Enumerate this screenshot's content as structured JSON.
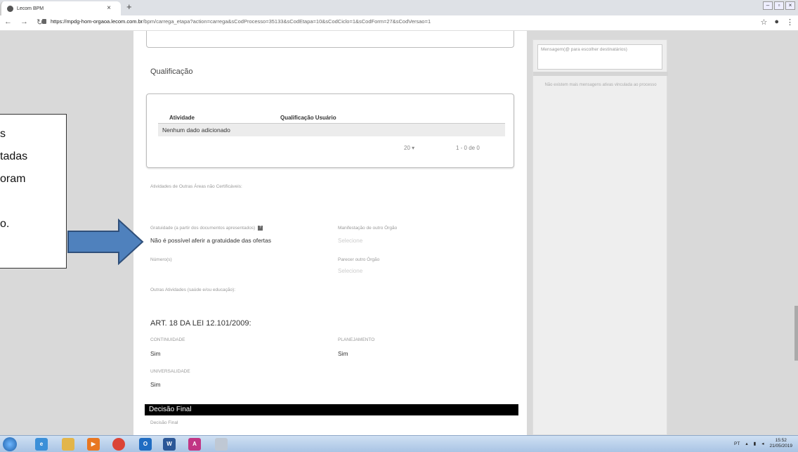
{
  "browser": {
    "tab_title": "Lecom BPM",
    "tab_close": "×",
    "new_tab": "+",
    "url_host": "https://mpdg-hom-orgaoa.lecom.com.br",
    "url_path": "/bpm/carrega_etapa?action=carrega&sCodProcesso=35133&sCodEtapa=10&sCodCiclo=1&sCodForm=27&sCodVersao=1"
  },
  "form": {
    "qualificacao_title": "Qualificação",
    "table": {
      "col_atividade": "Atividade",
      "col_qualificacao": "Qualificação Usuário",
      "empty_row": "Nenhum dado adicionado",
      "page_size": "20",
      "range": "1 - 0 de 0"
    },
    "outras_areas_label": "Atividades de Outras Áreas não Certificáveis:",
    "gratuidade_label": "Gratuidade (a partir dos documentos apresentados)",
    "gratuidade_value": "Não é possível aferir a gratuidade das ofertas",
    "manifestacao_label": "Manifestação de outro Órgão",
    "manifestacao_placeholder": "Selecione",
    "numeros_label": "Número(s)",
    "parecer_label": "Parecer outro Órgão",
    "parecer_placeholder": "Selecione",
    "outras_atividades_label": "Outras Atividades (saúde e/ou educação):",
    "art_title": "ART. 18 DA LEI 12.101/2009:",
    "continuidade_label": "CONTINUIDADE",
    "continuidade_value": "Sim",
    "planejamento_label": "PLANEJAMENTO",
    "planejamento_value": "Sim",
    "universalidade_label": "UNIVERSALIDADE",
    "universalidade_value": "Sim",
    "decisao_final_bar": "Decisão Final",
    "decisao_final_label": "Decisão Final"
  },
  "messages": {
    "input_placeholder": "Mensagem(@ para escolher destinatários)",
    "empty_text": "Não existem mais mensagens ativas vinculada ao processo"
  },
  "callout": {
    "lines": [
      "s",
      "tadas",
      "oram",
      "",
      "o."
    ]
  },
  "taskbar": {
    "lang": "PT",
    "time": "15:52",
    "date": "21/05/2019"
  },
  "colors": {
    "arrow_fill": "#4f81bd",
    "arrow_stroke": "#2f4f7a"
  }
}
